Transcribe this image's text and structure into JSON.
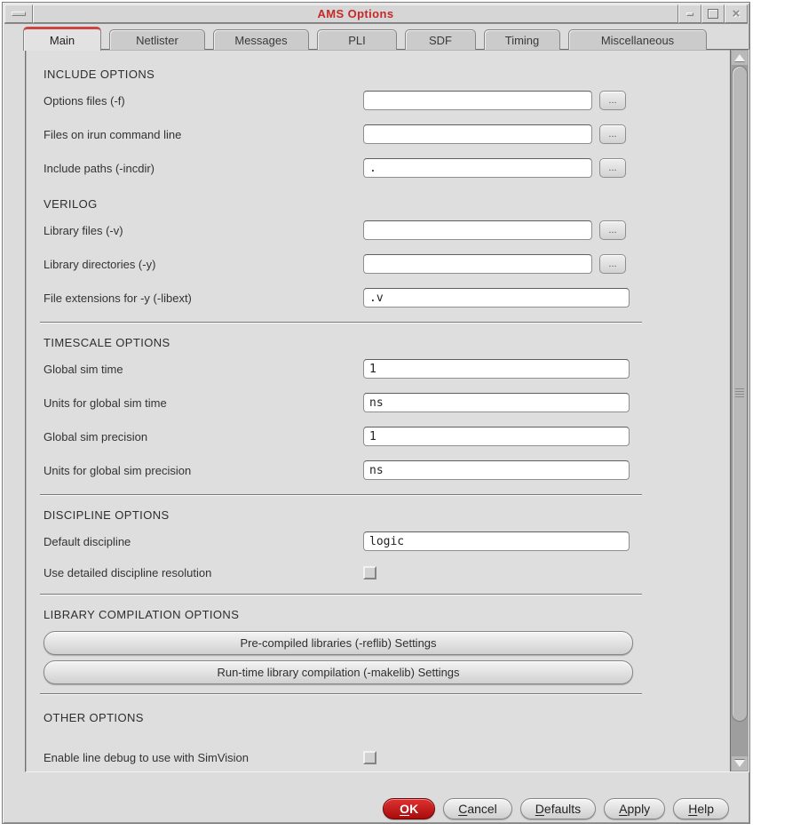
{
  "window": {
    "title": "AMS Options",
    "controls": {
      "close_glyph": "×"
    }
  },
  "tabs": [
    {
      "label": "Main",
      "active": true
    },
    {
      "label": "Netlister",
      "active": false
    },
    {
      "label": "Messages",
      "active": false
    },
    {
      "label": "PLI",
      "active": false
    },
    {
      "label": "SDF",
      "active": false
    },
    {
      "label": "Timing",
      "active": false
    },
    {
      "label": "Miscellaneous",
      "active": false
    }
  ],
  "form": {
    "browse_label": "...",
    "headers": {
      "include": "INCLUDE OPTIONS",
      "verilog": "VERILOG",
      "timescale": "TIMESCALE OPTIONS",
      "discipline": "DISCIPLINE OPTIONS",
      "library": "LIBRARY COMPILATION OPTIONS",
      "other": "OTHER OPTIONS"
    },
    "fields": {
      "options_files": {
        "label": "Options files (-f)",
        "value": ""
      },
      "irun_files": {
        "label": "Files on irun command line",
        "value": ""
      },
      "include_paths": {
        "label": "Include paths (-incdir)",
        "value": "."
      },
      "library_files": {
        "label": "Library files (-v)",
        "value": ""
      },
      "library_dirs": {
        "label": "Library directories (-y)",
        "value": ""
      },
      "libext": {
        "label": "File extensions for -y (-libext)",
        "value": ".v"
      },
      "global_sim_time": {
        "label": "Global sim time",
        "value": "1"
      },
      "global_sim_time_units": {
        "label": "Units for global sim time",
        "value": "ns"
      },
      "global_sim_precision": {
        "label": "Global sim precision",
        "value": "1"
      },
      "global_sim_precision_units": {
        "label": "Units for global sim precision",
        "value": "ns"
      },
      "default_discipline": {
        "label": "Default discipline",
        "value": "logic"
      }
    },
    "checkboxes": {
      "detailed_discipline": {
        "label": "Use detailed discipline resolution",
        "checked": false
      },
      "line_debug": {
        "label": "Enable line debug to use with SimVision",
        "checked": false
      }
    },
    "settings_buttons": {
      "reflib": "Pre-compiled libraries (-reflib) Settings",
      "makelib": "Run-time library compilation (-makelib) Settings"
    }
  },
  "footer": {
    "ok": "OK",
    "cancel": "Cancel",
    "defaults": "Defaults",
    "apply": "Apply",
    "help": "Help"
  },
  "colors": {
    "title_red": "#c62828",
    "tab_stripe_red": "#cc4444",
    "ok_button_red": "#b01010"
  }
}
